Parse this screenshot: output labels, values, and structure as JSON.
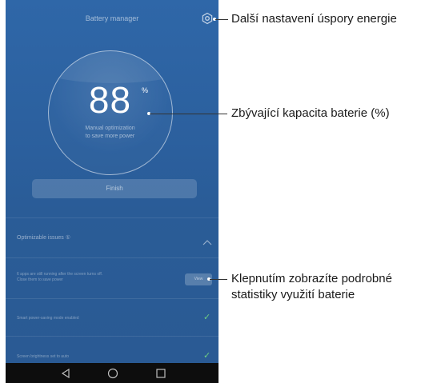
{
  "screen": {
    "title": "Battery manager",
    "battery_percent": "88",
    "percent_sign": "%",
    "hint_line1": "Manual optimization",
    "hint_line2": "to save more power",
    "finish_label": "Finish",
    "optimizable_header": "Optimizable issues",
    "optimizable_count": "①",
    "issues": [
      {
        "text_line1": "6 apps are still running after the screen turns off.",
        "text_line2": "Close them to save power",
        "action": "View"
      },
      {
        "text": "Smart power-saving mode enabled",
        "status": "✓"
      },
      {
        "text": "Screen brightness set to auto",
        "status": "✓"
      }
    ]
  },
  "nav": {
    "back": "back-icon",
    "home": "home-icon",
    "recents": "recents-icon"
  },
  "callouts": {
    "settings": "Další nastavení úspory energie",
    "capacity": "Zbývající kapacita baterie (%)",
    "details_line1": "Klepnutím zobrazíte podrobné",
    "details_line2": "statistiky využití baterie"
  },
  "colors": {
    "background": "#2b5f9d",
    "check": "#6fce82",
    "navbar": "#0d0d0d"
  }
}
